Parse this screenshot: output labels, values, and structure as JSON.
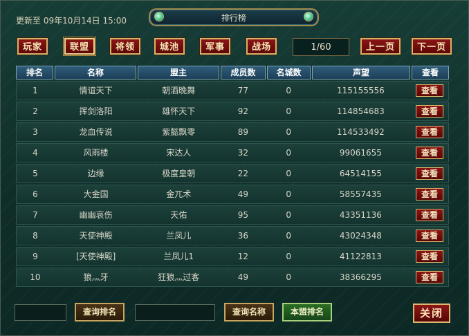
{
  "updated_text": "更新至 09年10月14日 15:00",
  "window_title": "排行榜",
  "tabs": [
    {
      "label": "玩家"
    },
    {
      "label": "联盟"
    },
    {
      "label": "将领"
    },
    {
      "label": "城池"
    },
    {
      "label": "军事"
    },
    {
      "label": "战场"
    }
  ],
  "pager": {
    "page": "1/60",
    "prev": "上一页",
    "next": "下一页"
  },
  "columns": [
    "排名",
    "名称",
    "盟主",
    "成员数",
    "名城数",
    "声望",
    "查看"
  ],
  "view_label": "查看",
  "rows": [
    {
      "rank": "1",
      "name": "情谊天下",
      "leader": "朝酒晚舞",
      "members": "77",
      "cities": "0",
      "prestige": "115155556"
    },
    {
      "rank": "2",
      "name": "挥剑洛阳",
      "leader": "雄怀天下",
      "members": "92",
      "cities": "0",
      "prestige": "114854683"
    },
    {
      "rank": "3",
      "name": "龙血传说",
      "leader": "紫懿飘零",
      "members": "89",
      "cities": "0",
      "prestige": "114533492"
    },
    {
      "rank": "4",
      "name": "风雨楼",
      "leader": "宋达人",
      "members": "32",
      "cities": "0",
      "prestige": "99061655"
    },
    {
      "rank": "5",
      "name": "边缘",
      "leader": "极度皇朝",
      "members": "22",
      "cities": "0",
      "prestige": "64514155"
    },
    {
      "rank": "6",
      "name": "大金国",
      "leader": "金兀术",
      "members": "49",
      "cities": "0",
      "prestige": "58557435"
    },
    {
      "rank": "7",
      "name": "幽幽哀伤",
      "leader": "天佑",
      "members": "95",
      "cities": "0",
      "prestige": "43351136"
    },
    {
      "rank": "8",
      "name": "天使神殿",
      "leader": "兰凤儿",
      "members": "36",
      "cities": "0",
      "prestige": "43024348"
    },
    {
      "rank": "9",
      "name": "[天使神殿]",
      "leader": "兰凤儿1",
      "members": "12",
      "cities": "0",
      "prestige": "41122813"
    },
    {
      "rank": "10",
      "name": "狼灬牙",
      "leader": "狂狼灬过客",
      "members": "49",
      "cities": "0",
      "prestige": "38366295"
    }
  ],
  "footer": {
    "rank_query_value": "",
    "query_rank": "查询排名",
    "name_query_value": "",
    "query_name": "查询名称",
    "my_alliance_rank": "本盟排名",
    "close": "关闭"
  }
}
